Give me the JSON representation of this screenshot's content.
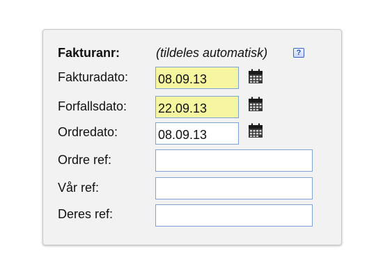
{
  "invoice_form": {
    "invoice_number": {
      "label": "Fakturanr:",
      "auto_note": "(tildeles automatisk)",
      "help_glyph": "?",
      "help_icon": "help-icon"
    },
    "invoice_date": {
      "label": "Fakturadato:",
      "value": "08.09.13",
      "highlighted": true,
      "icon": "calendar-icon"
    },
    "due_date": {
      "label": "Forfallsdato:",
      "value": "22.09.13",
      "highlighted": true,
      "icon": "calendar-icon"
    },
    "order_date": {
      "label": "Ordredato:",
      "value": "08.09.13",
      "highlighted": false,
      "icon": "calendar-icon"
    },
    "order_ref": {
      "label": "Ordre ref:",
      "value": ""
    },
    "our_ref": {
      "label": "Vår ref:",
      "value": ""
    },
    "their_ref": {
      "label": "Deres ref:",
      "value": ""
    }
  },
  "colors": {
    "panel_background": "#f2f2f2",
    "highlight_field": "#f6f5a0",
    "field_border": "#7ea3d6",
    "help_icon_blue": "#3a62c4"
  }
}
